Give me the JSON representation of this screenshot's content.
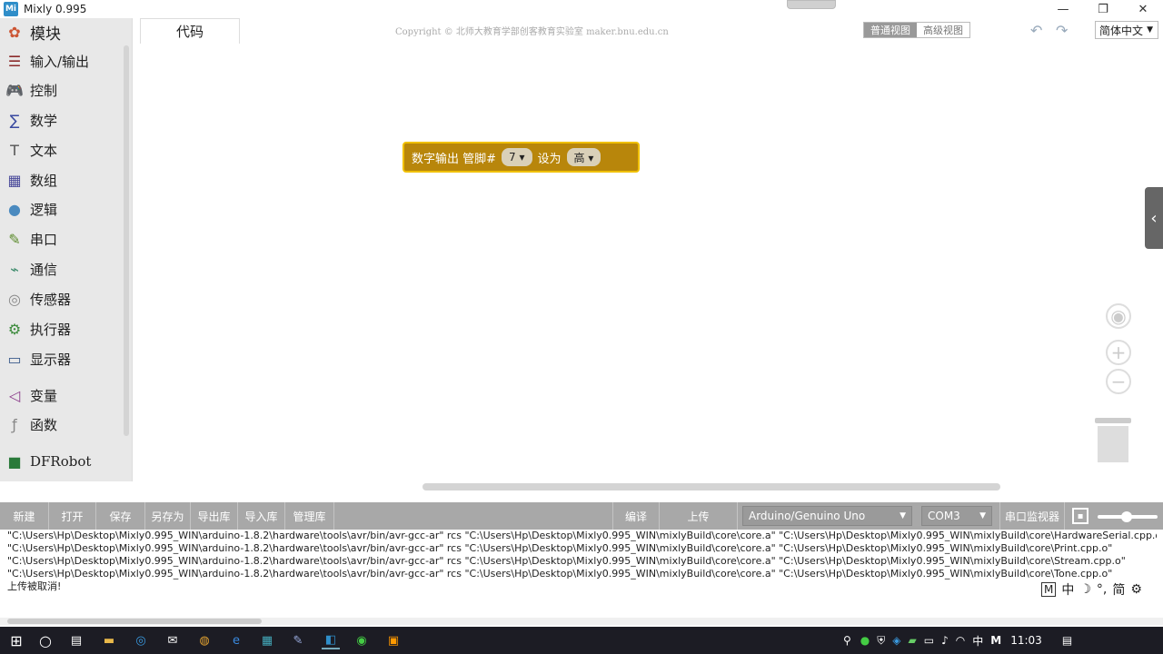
{
  "window": {
    "title": "Mixly 0.995",
    "logo_text": "Mi",
    "minimize": "—",
    "maximize": "❐",
    "close": "✕"
  },
  "sidebar": {
    "header": "模块",
    "items": [
      {
        "label": "输入/输出",
        "icon": "io-icon",
        "glyph": "☰",
        "color": "#8b2b2b"
      },
      {
        "label": "控制",
        "icon": "gamepad-icon",
        "glyph": "🎮",
        "color": "#4a6a8a"
      },
      {
        "label": "数学",
        "icon": "math-icon",
        "glyph": "∑",
        "color": "#3a4aa0"
      },
      {
        "label": "文本",
        "icon": "text-icon",
        "glyph": "T",
        "color": "#555"
      },
      {
        "label": "数组",
        "icon": "array-icon",
        "glyph": "▦",
        "color": "#4a4a9a"
      },
      {
        "label": "逻辑",
        "icon": "bulb-icon",
        "glyph": "●",
        "color": "#4a8abf"
      },
      {
        "label": "串口",
        "icon": "pen-icon",
        "glyph": "✎",
        "color": "#5a8a2a"
      },
      {
        "label": "通信",
        "icon": "satellite-icon",
        "glyph": "⌁",
        "color": "#3a8a6a"
      },
      {
        "label": "传感器",
        "icon": "sensor-icon",
        "glyph": "◎",
        "color": "#888"
      },
      {
        "label": "执行器",
        "icon": "actuator-icon",
        "glyph": "⚙",
        "color": "#3a8a3a"
      },
      {
        "label": "显示器",
        "icon": "monitor-icon",
        "glyph": "▭",
        "color": "#3a5a8a"
      },
      {
        "label": "变量",
        "icon": "variable-icon",
        "glyph": "◁",
        "color": "#8a3a8a"
      },
      {
        "label": "函数",
        "icon": "function-icon",
        "glyph": "ƒ",
        "color": "#888"
      },
      {
        "label": "DFRobot",
        "icon": "dfrobot-icon",
        "glyph": "■",
        "color": "#2a7a3a"
      }
    ]
  },
  "header": {
    "code_tab": "代码",
    "copyright": "Copyright © 北师大教育学部创客教育实验室 maker.bnu.edu.cn",
    "view_normal": "普通视图",
    "view_advanced": "高级视图",
    "language": "简体中文"
  },
  "block": {
    "label": "数字输出 管脚#",
    "pin": "7 ▾",
    "set_label": "设为",
    "value": "高 ▾"
  },
  "toolbar": {
    "new": "新建",
    "open": "打开",
    "save": "保存",
    "save_as": "另存为",
    "export_lib": "导出库",
    "import_lib": "导入库",
    "manage_lib": "管理库",
    "compile": "编译",
    "upload": "上传",
    "board": "Arduino/Genuino Uno",
    "port": "COM3",
    "serial_monitor": "串口监视器"
  },
  "console": {
    "lines": [
      "\"C:\\Users\\Hp\\Desktop\\Mixly0.995_WIN\\arduino-1.8.2\\hardware\\tools\\avr/bin/avr-gcc-ar\" rcs \"C:\\Users\\Hp\\Desktop\\Mixly0.995_WIN\\mixlyBuild\\core\\core.a\" \"C:\\Users\\Hp\\Desktop\\Mixly0.995_WIN\\mixlyBuild\\core\\HardwareSerial.cpp.o\"",
      "\"C:\\Users\\Hp\\Desktop\\Mixly0.995_WIN\\arduino-1.8.2\\hardware\\tools\\avr/bin/avr-gcc-ar\" rcs \"C:\\Users\\Hp\\Desktop\\Mixly0.995_WIN\\mixlyBuild\\core\\core.a\" \"C:\\Users\\Hp\\Desktop\\Mixly0.995_WIN\\mixlyBuild\\core\\Print.cpp.o\"",
      "\"C:\\Users\\Hp\\Desktop\\Mixly0.995_WIN\\arduino-1.8.2\\hardware\\tools\\avr/bin/avr-gcc-ar\" rcs \"C:\\Users\\Hp\\Desktop\\Mixly0.995_WIN\\mixlyBuild\\core\\core.a\" \"C:\\Users\\Hp\\Desktop\\Mixly0.995_WIN\\mixlyBuild\\core\\Stream.cpp.o\"",
      "\"C:\\Users\\Hp\\Desktop\\Mixly0.995_WIN\\arduino-1.8.2\\hardware\\tools\\avr/bin/avr-gcc-ar\" rcs \"C:\\Users\\Hp\\Desktop\\Mixly0.995_WIN\\mixlyBuild\\core\\core.a\" \"C:\\Users\\Hp\\Desktop\\Mixly0.995_WIN\\mixlyBuild\\core\\Tone.cpp.o\"",
      "上传被取消!"
    ]
  },
  "ime": {
    "mode": "M",
    "lang": "中",
    "moon": "☽",
    "punct": "°,",
    "simplified": "简",
    "settings": "⚙"
  },
  "taskbar": {
    "tray_lang": "中",
    "tray_m": "M",
    "time": "11:03"
  }
}
